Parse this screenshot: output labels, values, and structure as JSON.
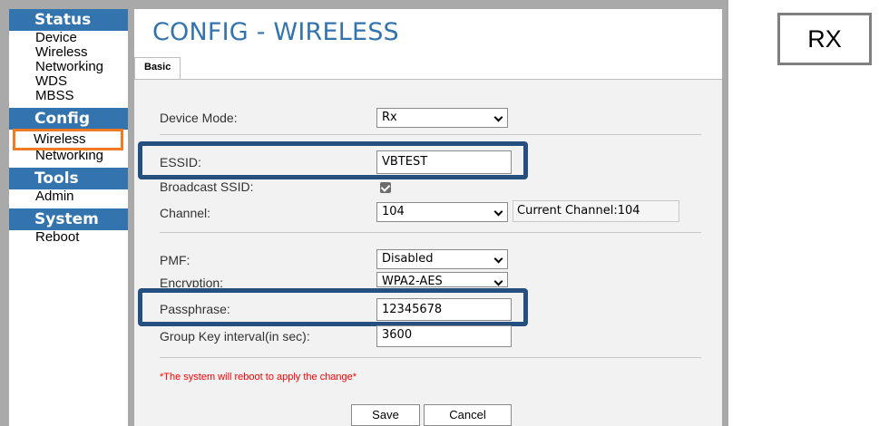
{
  "sidebar": {
    "status": {
      "heading": "Status",
      "items": [
        "Device",
        "Wireless",
        "Networking",
        "WDS",
        "MBSS"
      ]
    },
    "config": {
      "heading": "Config",
      "items": [
        "Wireless",
        "Networking"
      ]
    },
    "tools": {
      "heading": "Tools",
      "items": [
        "Admin"
      ]
    },
    "system": {
      "heading": "System",
      "items": [
        "Reboot"
      ]
    }
  },
  "page_title": "CONFIG - WIRELESS",
  "tabs": [
    "Basic"
  ],
  "form": {
    "device_mode": {
      "label": "Device Mode:",
      "value": "Rx"
    },
    "essid": {
      "label": "ESSID:",
      "value": "VBTEST"
    },
    "broadcast_ssid": {
      "label": "Broadcast SSID:",
      "checked": true
    },
    "channel": {
      "label": "Channel:",
      "value": "104",
      "current": "Current Channel:104"
    },
    "pmf": {
      "label": "PMF:",
      "value": "Disabled"
    },
    "encryption": {
      "label": "Encryption:",
      "value": "WPA2-AES"
    },
    "passphrase": {
      "label": "Passphrase:",
      "value": "12345678"
    },
    "group_key": {
      "label": "Group Key interval(in sec):",
      "value": "3600"
    }
  },
  "warning": "*The system will reboot to apply the change*",
  "buttons": {
    "save": "Save",
    "cancel": "Cancel"
  },
  "rx_label": "RX",
  "colors": {
    "accent": "#3373ae",
    "highlight_box": "#244f7e",
    "orange_highlight": "#f07b24",
    "warning": "#ff0000"
  }
}
